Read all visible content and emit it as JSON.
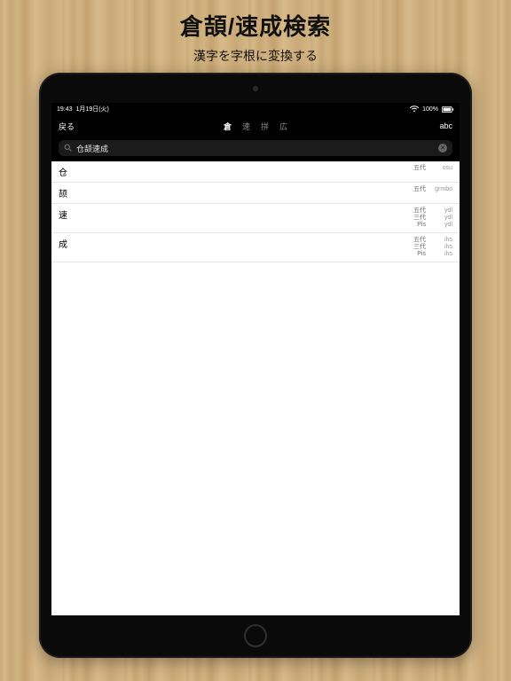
{
  "page": {
    "title": "倉頡/速成検索",
    "subtitle": "漢字を字根に変換する"
  },
  "statusbar": {
    "time": "19:43",
    "date": "1月19日(火)",
    "battery": "100%"
  },
  "navbar": {
    "back": "戻る",
    "tabs": [
      "倉",
      "速",
      "拼",
      "広"
    ],
    "active_index": 0,
    "right": "abc"
  },
  "search": {
    "value": "仓颉速成",
    "placeholder": ""
  },
  "results": [
    {
      "char": "仓",
      "codes": [
        {
          "label": "五代",
          "code": "osu"
        }
      ]
    },
    {
      "char": "颉",
      "codes": [
        {
          "label": "五代",
          "code": "grmbo"
        }
      ]
    },
    {
      "char": "速",
      "codes": [
        {
          "label": "五代",
          "code": "ydl"
        },
        {
          "label": "三代",
          "code": "ydl"
        },
        {
          "label": "Pis",
          "code": "ydl"
        }
      ]
    },
    {
      "char": "成",
      "codes": [
        {
          "label": "五代",
          "code": "ihs"
        },
        {
          "label": "三代",
          "code": "ihs"
        },
        {
          "label": "Pis",
          "code": "ihs"
        }
      ]
    }
  ],
  "icons": {
    "search": "search-icon",
    "clear": "clear-icon",
    "wifi": "wifi-icon",
    "battery": "battery-icon"
  }
}
